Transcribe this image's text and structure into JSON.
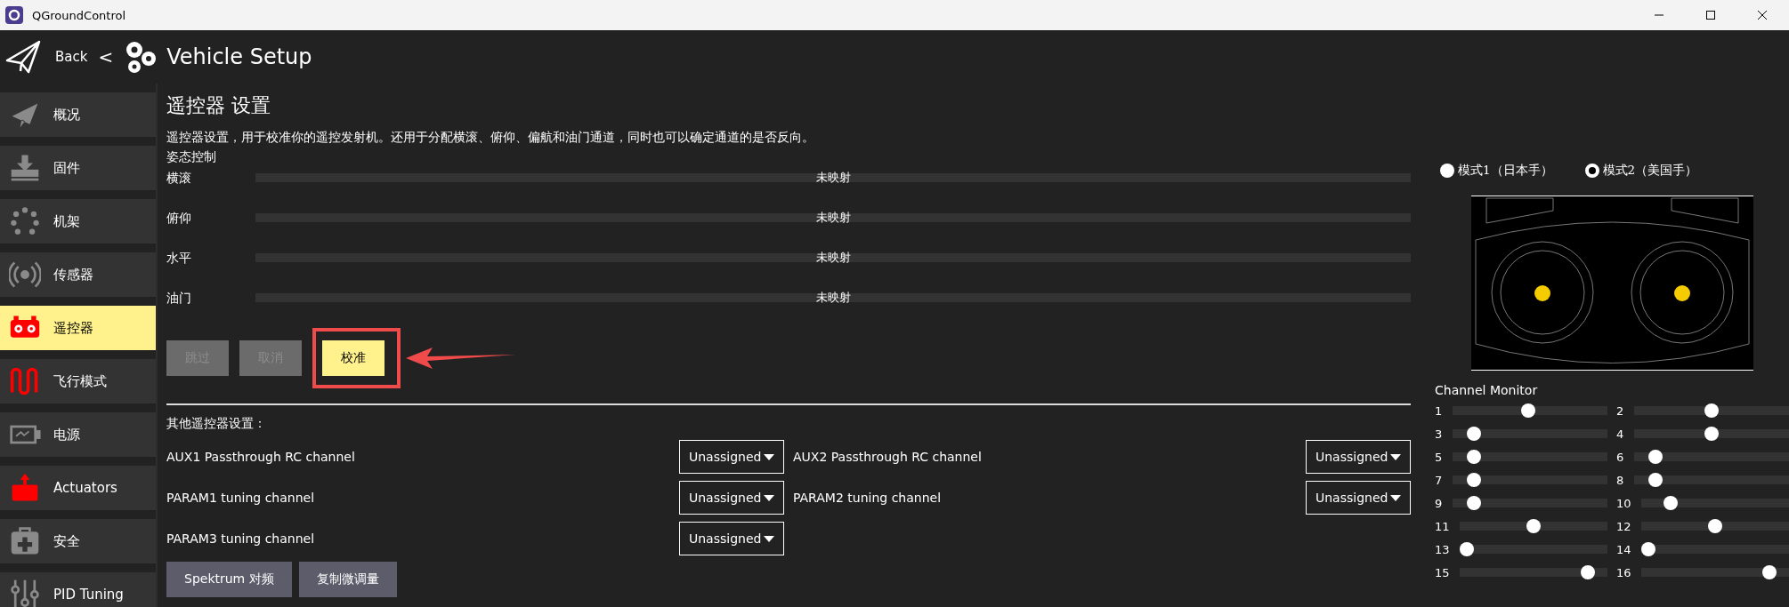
{
  "window": {
    "title": "QGroundControl"
  },
  "header": {
    "back": "Back",
    "separator": "<",
    "title": "Vehicle Setup"
  },
  "sidebar": {
    "items": [
      {
        "label": "概况",
        "selected": false,
        "needs_setup": false
      },
      {
        "label": "固件",
        "selected": false,
        "needs_setup": false
      },
      {
        "label": "机架",
        "selected": false,
        "needs_setup": false
      },
      {
        "label": "传感器",
        "selected": false,
        "needs_setup": false
      },
      {
        "label": "遥控器",
        "selected": true,
        "needs_setup": true
      },
      {
        "label": "飞行模式",
        "selected": false,
        "needs_setup": true
      },
      {
        "label": "电源",
        "selected": false,
        "needs_setup": false
      },
      {
        "label": "Actuators",
        "selected": false,
        "needs_setup": true
      },
      {
        "label": "安全",
        "selected": false,
        "needs_setup": false
      },
      {
        "label": "PID Tuning",
        "selected": false,
        "needs_setup": false
      }
    ]
  },
  "page": {
    "title": "遥控器 设置",
    "description": "遥控器设置，用于校准你的遥控发射机。还用于分配横滚、俯仰、偏航和油门通道，同时也可以确定通道的是否反向。",
    "attitude_heading": "姿态控制",
    "attitude_rows": [
      {
        "label": "横滚",
        "value": "未映射"
      },
      {
        "label": "俯仰",
        "value": "未映射"
      },
      {
        "label": "水平",
        "value": "未映射"
      },
      {
        "label": "油门",
        "value": "未映射"
      }
    ],
    "buttons": [
      {
        "label": "跳过",
        "disabled": true,
        "highlighted": false
      },
      {
        "label": "取消",
        "disabled": true,
        "highlighted": false
      },
      {
        "label": "校准",
        "disabled": false,
        "highlighted": true
      }
    ],
    "other_heading": "其他遥控器设置：",
    "other_settings": [
      {
        "label": "AUX1 Passthrough RC channel",
        "value": "Unassigned"
      },
      {
        "label": "AUX2 Passthrough RC channel",
        "value": "Unassigned"
      },
      {
        "label": "PARAM1 tuning channel",
        "value": "Unassigned"
      },
      {
        "label": "PARAM2 tuning channel",
        "value": "Unassigned"
      },
      {
        "label": "PARAM3 tuning channel",
        "value": "Unassigned"
      }
    ],
    "bottom_buttons": [
      "Spektrum 对频",
      "复制微调量"
    ]
  },
  "modes": [
    {
      "label": "模式1（日本手）",
      "selected": false
    },
    {
      "label": "模式2（美国手）",
      "selected": true
    }
  ],
  "channel_monitor": {
    "title": "Channel Monitor",
    "channels": [
      {
        "number": "1",
        "level": 0.49
      },
      {
        "number": "2",
        "level": 0.5
      },
      {
        "number": "3",
        "level": 0.14
      },
      {
        "number": "4",
        "level": 0.5
      },
      {
        "number": "5",
        "level": 0.14
      },
      {
        "number": "6",
        "level": 0.14
      },
      {
        "number": "7",
        "level": 0.14
      },
      {
        "number": "8",
        "level": 0.14
      },
      {
        "number": "9",
        "level": 0.14
      },
      {
        "number": "10",
        "level": 0.2
      },
      {
        "number": "11",
        "level": 0.5
      },
      {
        "number": "12",
        "level": 0.5
      },
      {
        "number": "13",
        "level": 0.05
      },
      {
        "number": "14",
        "level": 0.05
      },
      {
        "number": "15",
        "level": 0.87
      },
      {
        "number": "16",
        "level": 0.87
      }
    ]
  }
}
